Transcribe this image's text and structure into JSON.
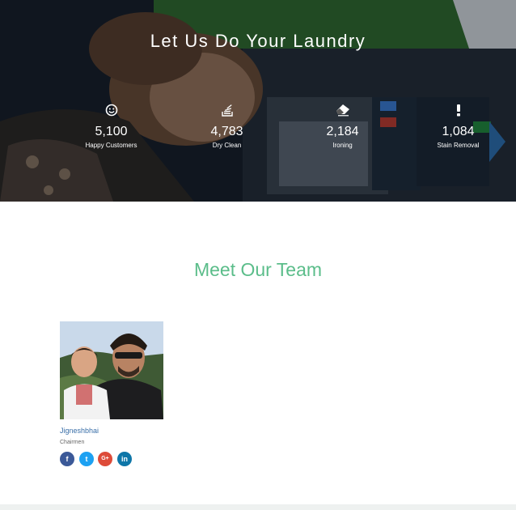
{
  "hero": {
    "title": "Let Us Do Your Laundry",
    "stats": [
      {
        "icon": "smiley-icon",
        "value": "5,100",
        "label": "Happy Customers"
      },
      {
        "icon": "stack-icon",
        "value": "4,783",
        "label": "Dry Clean"
      },
      {
        "icon": "eraser-icon",
        "value": "2,184",
        "label": "Ironing"
      },
      {
        "icon": "exclamation-icon",
        "value": "1,084",
        "label": "Stain Removal"
      }
    ]
  },
  "team": {
    "title": "Meet Our Team",
    "members": [
      {
        "name": "Jigneshbhai",
        "role": "Chairmen",
        "socials": [
          {
            "network": "facebook",
            "glyph": "f",
            "color": "#3b5998"
          },
          {
            "network": "twitter",
            "glyph": "t",
            "color": "#1da1f2"
          },
          {
            "network": "google-plus",
            "glyph": "G+",
            "color": "#dd4b39"
          },
          {
            "network": "linkedin",
            "glyph": "in",
            "color": "#0e76a8"
          }
        ]
      }
    ]
  },
  "colors": {
    "accent_green": "#5bbd8a",
    "name_blue": "#3a6fa8",
    "hero_dark": "#151c26"
  }
}
